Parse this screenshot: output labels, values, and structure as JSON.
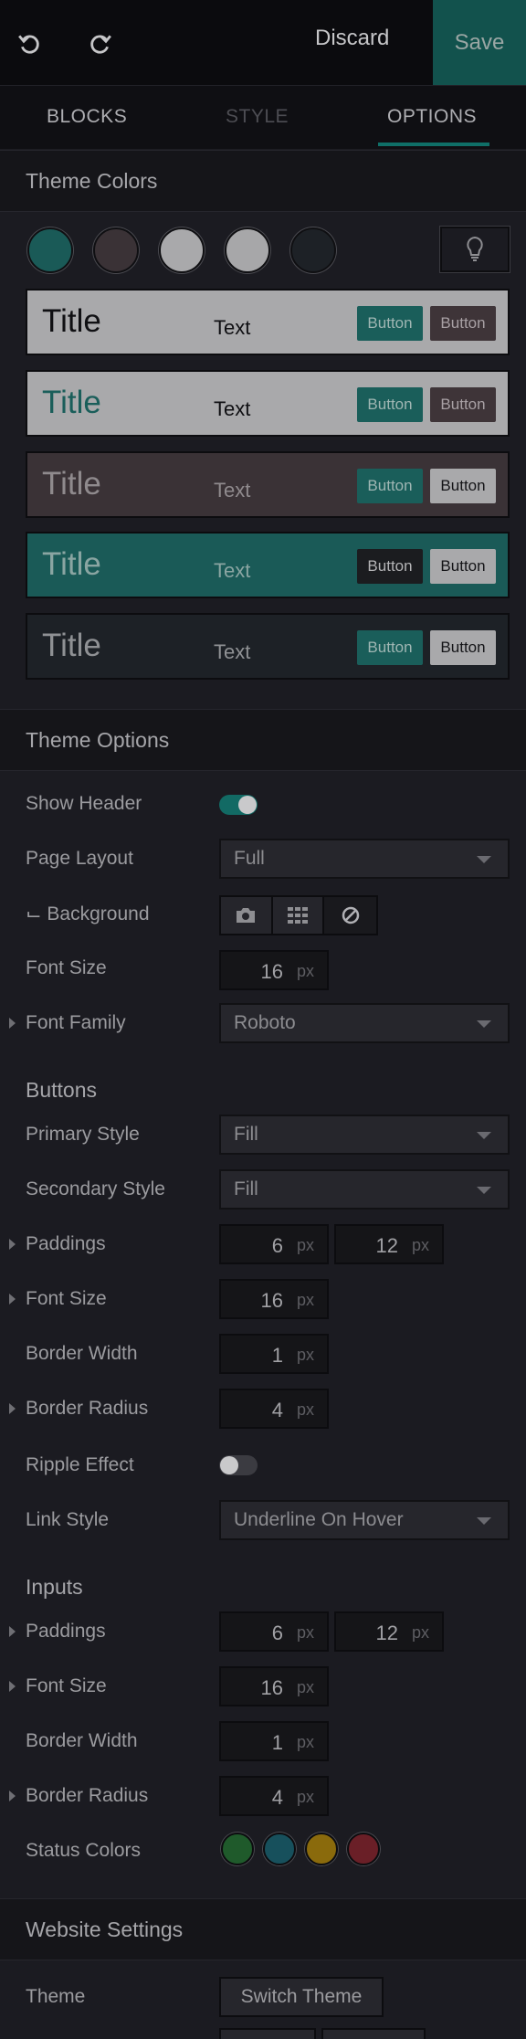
{
  "topbar": {
    "discard_label": "Discard",
    "save_label": "Save",
    "undo_icon": "undo-icon",
    "redo_icon": "redo-icon"
  },
  "tabs": [
    {
      "label": "BLOCKS"
    },
    {
      "label": "STYLE"
    },
    {
      "label": "OPTIONS",
      "active": true
    }
  ],
  "theme_colors": {
    "heading": "Theme Colors",
    "swatches": [
      "#1a5a57",
      "#3a3236",
      "#a9a9ab",
      "#a7a7a9",
      "#1d2126"
    ],
    "bulb_icon": "lightbulb-icon",
    "rows": [
      {
        "title": "Title",
        "text": "Text",
        "button1": "Button",
        "button2": "Button",
        "bg": "#a9a9ab",
        "title_color": "#101013",
        "text_color": "#101013",
        "b1_bg": "#1a5e5a",
        "b1_color": "#9fb6b3",
        "b2_bg": "#3e3438",
        "b2_color": "#a8a0a4"
      },
      {
        "title": "Title",
        "text": "Text",
        "button1": "Button",
        "button2": "Button",
        "bg": "#a9a9ab",
        "title_color": "#1a5e5a",
        "text_color": "#101013",
        "b1_bg": "#1a5e5a",
        "b1_color": "#9fb6b3",
        "b2_bg": "#3e3438",
        "b2_color": "#a8a0a4"
      },
      {
        "title": "Title",
        "text": "Text",
        "button1": "Button",
        "button2": "Button",
        "bg": "#3a3236",
        "title_color": "#8f8a8d",
        "text_color": "#8f8a8d",
        "b1_bg": "#1a5e5a",
        "b1_color": "#9fb6b3",
        "b2_bg": "#a9a9ab",
        "b2_color": "#151518"
      },
      {
        "title": "Title",
        "text": "Text",
        "button1": "Button",
        "button2": "Button",
        "bg": "#1a5a57",
        "title_color": "#8aa5a2",
        "text_color": "#8aa5a2",
        "b1_bg": "#1b1c1f",
        "b1_color": "#b4b4b6",
        "b2_bg": "#a9a9ab",
        "b2_color": "#151518"
      },
      {
        "title": "Title",
        "text": "Text",
        "button1": "Button",
        "button2": "Button",
        "bg": "#1d2126",
        "title_color": "#8f9194",
        "text_color": "#8f9194",
        "b1_bg": "#1a5e5a",
        "b1_color": "#9fb6b3",
        "b2_bg": "#a9a9ab",
        "b2_color": "#151518"
      }
    ]
  },
  "theme_options": {
    "heading": "Theme Options",
    "show_header": "Show Header",
    "page_layout": "Page Layout",
    "page_layout_value": "Full",
    "background": "⌙ Background",
    "font_size": "Font Size",
    "font_size_value": "16",
    "font_family": "Font Family",
    "font_family_value": "Roboto",
    "unit": "px"
  },
  "buttons": {
    "heading": "Buttons",
    "primary_style": "Primary Style",
    "primary_style_value": "Fill",
    "secondary_style": "Secondary Style",
    "secondary_style_value": "Fill",
    "paddings": "Paddings",
    "padding_v": "6",
    "padding_h": "12",
    "font_size": "Font Size",
    "font_size_value": "16",
    "border_width": "Border Width",
    "border_width_value": "1",
    "border_radius": "Border Radius",
    "border_radius_value": "4",
    "ripple_effect": "Ripple Effect",
    "link_style": "Link Style",
    "link_style_value": "Underline On Hover"
  },
  "inputs": {
    "heading": "Inputs",
    "paddings": "Paddings",
    "padding_v": "6",
    "padding_h": "12",
    "font_size": "Font Size",
    "font_size_value": "16",
    "border_width": "Border Width",
    "border_width_value": "1",
    "border_radius": "Border Radius",
    "border_radius_value": "4",
    "status_colors": "Status Colors",
    "status_swatches": [
      "#1f5a2b",
      "#17505c",
      "#8a6a0c",
      "#6a1f27"
    ]
  },
  "website_settings": {
    "heading": "Website Settings",
    "theme": "Theme",
    "switch_theme": "Switch Theme"
  },
  "colors": {
    "accent": "#0f6f68",
    "toggle_on": "#126a64",
    "toggle_off": "#3b3b41"
  }
}
